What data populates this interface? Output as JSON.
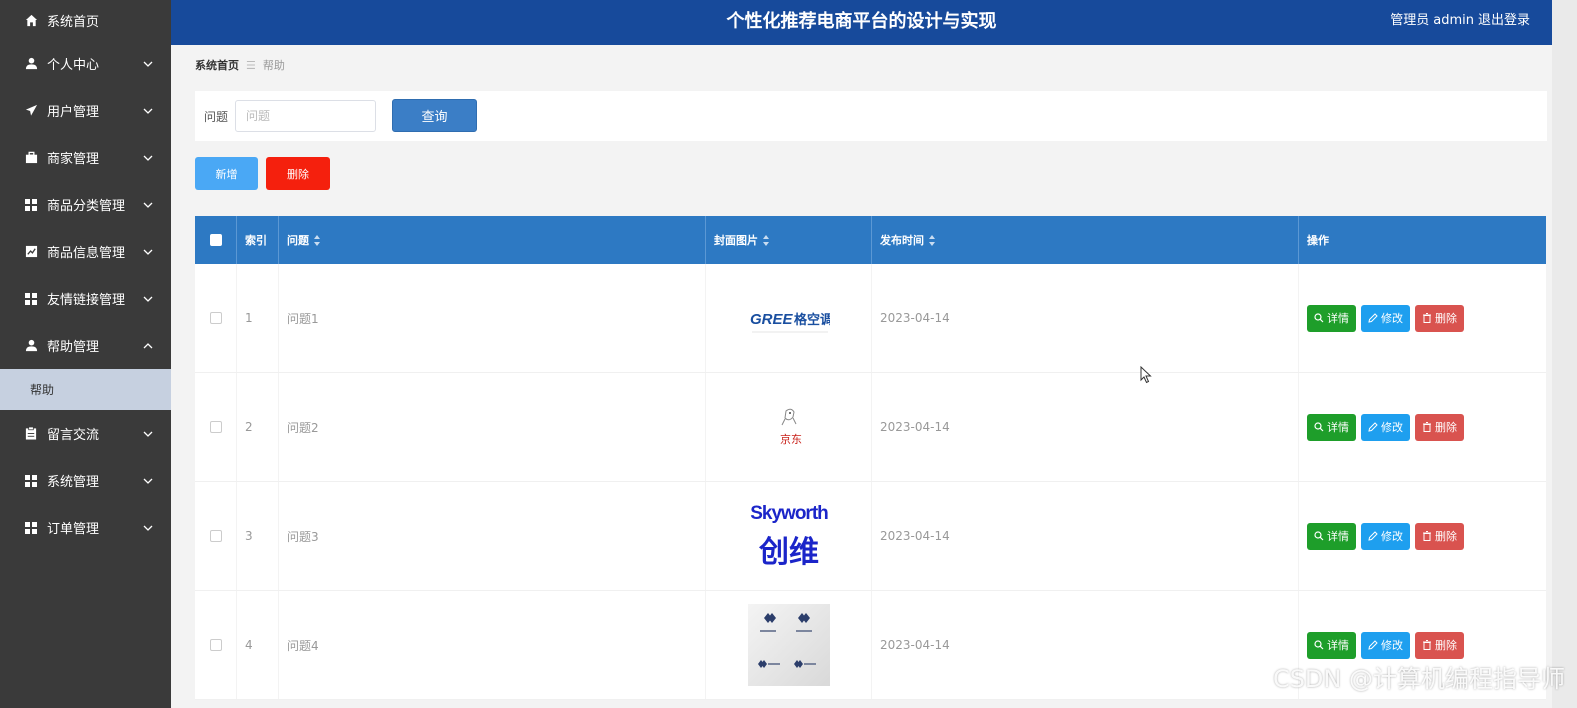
{
  "header": {
    "title": "个性化推荐电商平台的设计与实现",
    "role": "管理员",
    "username": "admin",
    "logout": "退出登录"
  },
  "sidebar": {
    "items": [
      {
        "label": "系统首页",
        "icon": "home-icon"
      },
      {
        "label": "个人中心",
        "icon": "user-icon"
      },
      {
        "label": "用户管理",
        "icon": "send-icon"
      },
      {
        "label": "商家管理",
        "icon": "briefcase-icon"
      },
      {
        "label": "商品分类管理",
        "icon": "grid-icon"
      },
      {
        "label": "商品信息管理",
        "icon": "chart-icon"
      },
      {
        "label": "友情链接管理",
        "icon": "grid-icon"
      },
      {
        "label": "帮助管理",
        "icon": "user-icon"
      },
      {
        "label": "留言交流",
        "icon": "clipboard-icon"
      },
      {
        "label": "系统管理",
        "icon": "grid-icon"
      },
      {
        "label": "订单管理",
        "icon": "grid-icon"
      }
    ],
    "submenu": {
      "label": "帮助"
    }
  },
  "breadcrumb": {
    "home": "系统首页",
    "current": "帮助"
  },
  "search": {
    "label": "问题",
    "placeholder": "问题",
    "button": "查询"
  },
  "actions": {
    "add": "新增",
    "delete": "删除"
  },
  "table": {
    "headers": {
      "index": "索引",
      "question": "问题",
      "cover": "封面图片",
      "date": "发布时间",
      "ops": "操作"
    },
    "ops": {
      "detail": "详情",
      "edit": "修改",
      "delete": "删除"
    },
    "rows": [
      {
        "index": "1",
        "question": "问题1",
        "cover": "GREE格力空调",
        "date": "2023-04-14"
      },
      {
        "index": "2",
        "question": "问题2",
        "cover": "京东",
        "date": "2023-04-14"
      },
      {
        "index": "3",
        "question": "问题3",
        "cover": "Skyworth 创维",
        "date": "2023-04-14"
      },
      {
        "index": "4",
        "question": "问题4",
        "cover": "brand logo",
        "date": "2023-04-14"
      }
    ]
  },
  "watermark": "CSDN @计算机编程指导师",
  "colors": {
    "header": "#174a9b",
    "sidebar": "#3a3a3a",
    "table_head": "#2d79c3",
    "detail": "#1e9e2a",
    "edit": "#1e9fef",
    "delete": "#d9534f",
    "add": "#4aa8f5",
    "delete_batch": "#f5200d"
  }
}
